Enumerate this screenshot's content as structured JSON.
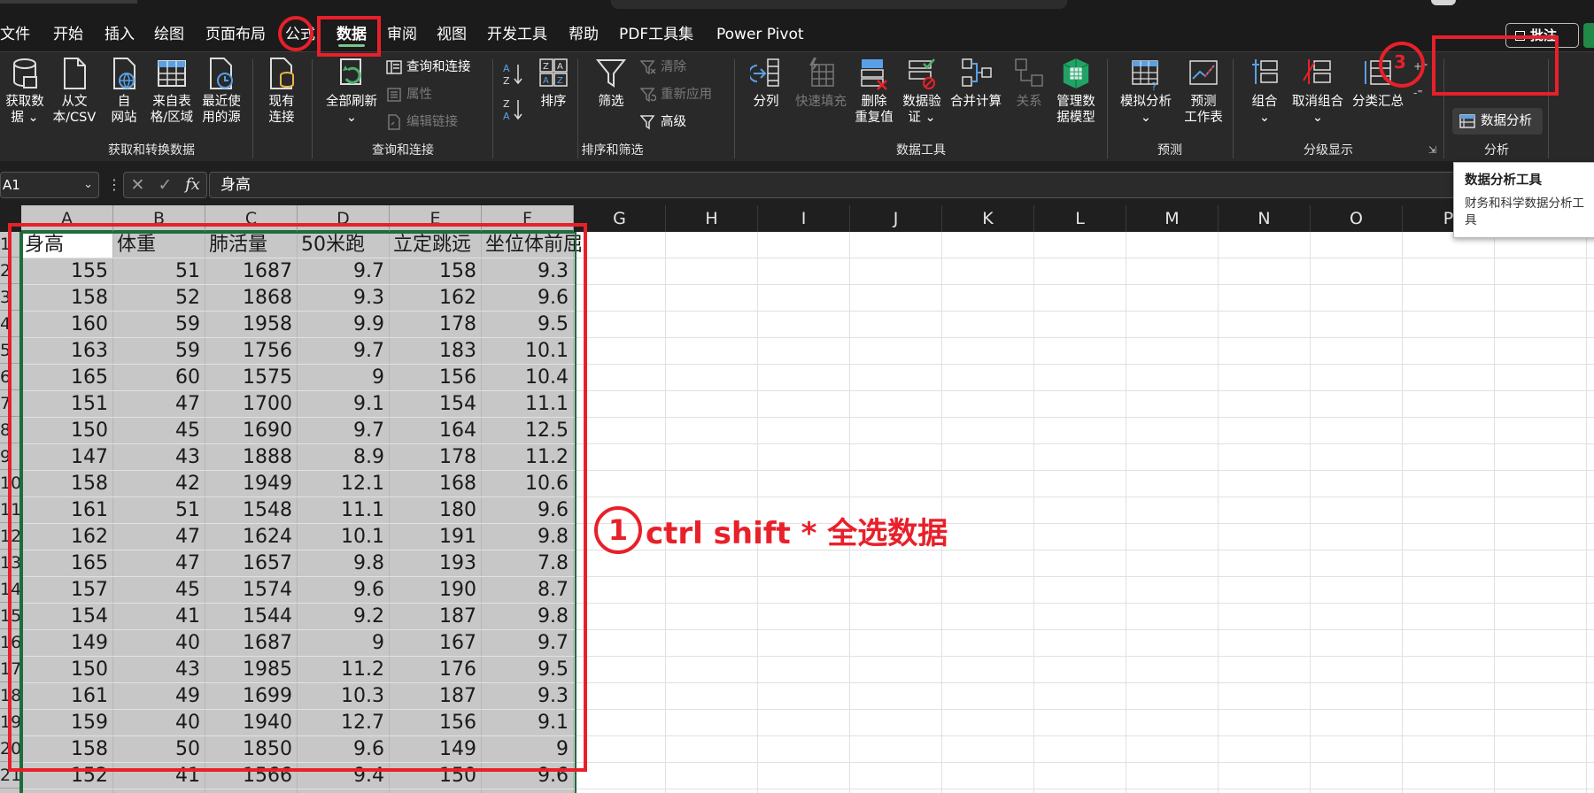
{
  "tabs": [
    {
      "label": "文件",
      "active": false
    },
    {
      "label": "开始",
      "active": false
    },
    {
      "label": "插入",
      "active": false
    },
    {
      "label": "绘图",
      "active": false
    },
    {
      "label": "页面布局",
      "active": false
    },
    {
      "label": "公式",
      "active": false
    },
    {
      "label": "数据",
      "active": true
    },
    {
      "label": "审阅",
      "active": false
    },
    {
      "label": "视图",
      "active": false
    },
    {
      "label": "开发工具",
      "active": false
    },
    {
      "label": "帮助",
      "active": false
    },
    {
      "label": "PDF工具集",
      "active": false
    },
    {
      "label": "Power Pivot",
      "active": false
    }
  ],
  "share_label": "批注",
  "ribbon": {
    "get_data": {
      "group": "获取和转换数据",
      "get_data_label": "获取数\n据 ⌄",
      "from_text_label": "从文\n本/CSV",
      "from_web_label": "自\n网站",
      "from_table_label": "来自表\n格/区域",
      "recent_label": "最近使\n用的源",
      "existing_label": "现有\n连接"
    },
    "queries": {
      "group": "查询和连接",
      "refresh_label": "全部刷新\n⌄",
      "queries_label": "查询和连接",
      "properties_label": "属性",
      "edit_links_label": "编辑链接"
    },
    "sort_filter": {
      "group": "排序和筛选",
      "sort_label": "排序",
      "filter_label": "筛选",
      "clear_label": "清除",
      "reapply_label": "重新应用",
      "advanced_label": "高级"
    },
    "data_tools": {
      "group": "数据工具",
      "split_label": "分列",
      "flash_fill_label": "快速填充",
      "remove_dup_label": "删除\n重复值",
      "validation_label": "数据验\n证 ⌄",
      "consolidate_label": "合并计算",
      "relations_label": "关系",
      "data_model_label": "管理数\n据模型"
    },
    "forecast": {
      "group": "预测",
      "what_if_label": "模拟分析\n⌄",
      "forecast_sheet_label": "预测\n工作表"
    },
    "outline": {
      "group": "分级显示",
      "group_label": "组合\n⌄",
      "ungroup_label": "取消组合\n⌄",
      "subtotal_label": "分类汇总"
    },
    "analysis": {
      "group": "分析",
      "data_analysis_label": "数据分析"
    }
  },
  "formula_bar": {
    "name_box": "A1",
    "dots": "⋮",
    "cancel": "✕",
    "enter": "✓",
    "fx": "fx",
    "content": "身高"
  },
  "columns": [
    "A",
    "B",
    "C",
    "D",
    "E",
    "F",
    "G",
    "H",
    "I",
    "J",
    "K",
    "L",
    "M",
    "N",
    "O",
    "P"
  ],
  "rows": [
    "1",
    "2",
    "3",
    "4",
    "5",
    "6",
    "7",
    "8",
    "9",
    "10",
    "11",
    "12",
    "13",
    "14",
    "15",
    "16",
    "17",
    "18",
    "19",
    "20",
    "21"
  ],
  "sheet": {
    "headers": [
      "身高",
      "体重",
      "肺活量",
      "50米跑",
      "立定跳远",
      "坐位体前屈"
    ],
    "data": [
      [
        "155",
        "51",
        "1687",
        "9.7",
        "158",
        "9.3"
      ],
      [
        "158",
        "52",
        "1868",
        "9.3",
        "162",
        "9.6"
      ],
      [
        "160",
        "59",
        "1958",
        "9.9",
        "178",
        "9.5"
      ],
      [
        "163",
        "59",
        "1756",
        "9.7",
        "183",
        "10.1"
      ],
      [
        "165",
        "60",
        "1575",
        "9",
        "156",
        "10.4"
      ],
      [
        "151",
        "47",
        "1700",
        "9.1",
        "154",
        "11.1"
      ],
      [
        "150",
        "45",
        "1690",
        "9.7",
        "164",
        "12.5"
      ],
      [
        "147",
        "43",
        "1888",
        "8.9",
        "178",
        "11.2"
      ],
      [
        "158",
        "42",
        "1949",
        "12.1",
        "168",
        "10.6"
      ],
      [
        "161",
        "51",
        "1548",
        "11.1",
        "180",
        "9.6"
      ],
      [
        "162",
        "47",
        "1624",
        "10.1",
        "191",
        "9.8"
      ],
      [
        "165",
        "47",
        "1657",
        "9.8",
        "193",
        "7.8"
      ],
      [
        "157",
        "45",
        "1574",
        "9.6",
        "190",
        "8.7"
      ],
      [
        "154",
        "41",
        "1544",
        "9.2",
        "187",
        "9.8"
      ],
      [
        "149",
        "40",
        "1687",
        "9",
        "167",
        "9.7"
      ],
      [
        "150",
        "43",
        "1985",
        "11.2",
        "176",
        "9.5"
      ],
      [
        "161",
        "49",
        "1699",
        "10.3",
        "187",
        "9.3"
      ],
      [
        "159",
        "40",
        "1940",
        "12.7",
        "156",
        "9.1"
      ],
      [
        "158",
        "50",
        "1850",
        "9.6",
        "149",
        "9"
      ],
      [
        "152",
        "41",
        "1566",
        "9.4",
        "150",
        "9.6"
      ]
    ]
  },
  "annotations": {
    "step1_number": "1",
    "step1_text": "ctrl shift * 全选数据",
    "step3_number": "3"
  },
  "tooltip": {
    "title": "数据分析工具",
    "description": "财务和科学数据分析工具"
  },
  "colors": {
    "accent_green": "#1f6b3c",
    "annotation_red": "#e8202a",
    "ribbon_bg": "#292929",
    "selection_gray": "#c7c7c7"
  }
}
